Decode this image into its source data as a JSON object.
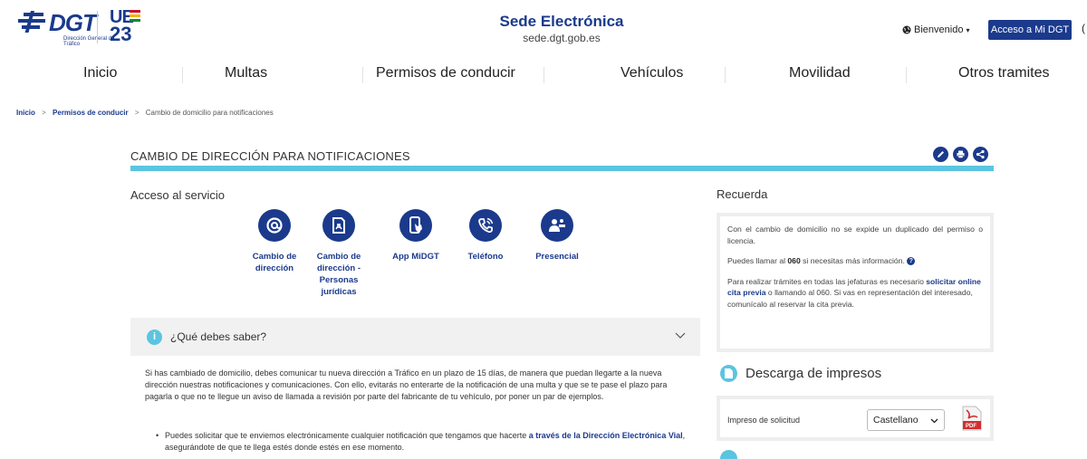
{
  "header": {
    "logo": {
      "text": "DGT",
      "subtitle": "Dirección General de Tráfico"
    },
    "ue_logo": {
      "top": "UE",
      "bottom": "23"
    },
    "site_title": "Sede Electrónica",
    "site_url": "sede.dgt.gob.es",
    "welcome": "Bienvenido",
    "acceso_button": "Acceso a Mi DGT",
    "edge_text": "("
  },
  "nav": {
    "items": [
      "Inicio",
      "Multas",
      "Permisos de conducir",
      "Vehículos",
      "Movilidad",
      "Otros tramites"
    ]
  },
  "breadcrumb": {
    "items": [
      "Inicio",
      "Permisos de conducir",
      "Cambio de domicilio para notificaciones"
    ],
    "separator": ">"
  },
  "page": {
    "title": "CAMBIO DE DIRECCIÓN PARA NOTIFICACIONES",
    "tools": [
      "edit-icon",
      "print-icon",
      "share-icon"
    ]
  },
  "acceso": {
    "label": "Acceso al servicio",
    "services": [
      {
        "icon": "at-sign-icon",
        "label": "Cambio de dirección"
      },
      {
        "icon": "document-icon",
        "label": "Cambio de dirección - Personas jurídicas"
      },
      {
        "icon": "mobile-app-icon",
        "label": "App MiDGT"
      },
      {
        "icon": "phone-icon",
        "label": "Teléfono"
      },
      {
        "icon": "people-icon",
        "label": "Presencial"
      }
    ]
  },
  "accordion": {
    "title": "¿Qué debes saber?",
    "body": "Si has cambiado de domicilio, debes comunicar tu nueva dirección a Tráfico en un plazo de 15 días, de manera que puedan llegarte a la nueva dirección nuestras notificaciones y comunicaciones. Con ello, evitarás no enterarte de la notificación de una multa y que se te pase el plazo para pagarla o que no te llegue un aviso de llamada a revisión por parte del fabricante de tu vehículo, por poner un par de ejemplos.",
    "bullet1_a": "Puedes solicitar que te enviemos electrónicamente cualquier notificación que tengamos que hacerte ",
    "bullet1_link": "a través de la Dirección Electrónica Vial",
    "bullet1_b": ", asegurándote de que te llega estés donde estés en ese momento."
  },
  "recuerda": {
    "title": "Recuerda",
    "p1": "Con el cambio de domicilio no se expide un duplicado del permiso o licencia.",
    "p2_a": "Puedes llamar al ",
    "p2_bold": "060",
    "p2_b": " si necesitas más información.",
    "p3_a": "Para realizar trámites en todas las jefaturas es necesario ",
    "p3_link": "solicitar online cita previa",
    "p3_b": " o llamando al 060. Si vas en representación del interesado, comunícalo al reservar la cita previa."
  },
  "descarga": {
    "title": "Descarga de impresos",
    "item_label": "Impreso de solicitud",
    "language": "Castellano",
    "pdf_label": "PDF"
  },
  "colors": {
    "brand": "#1b3a8c",
    "accent": "#5bc4e0",
    "panel": "#f1f1f1"
  }
}
